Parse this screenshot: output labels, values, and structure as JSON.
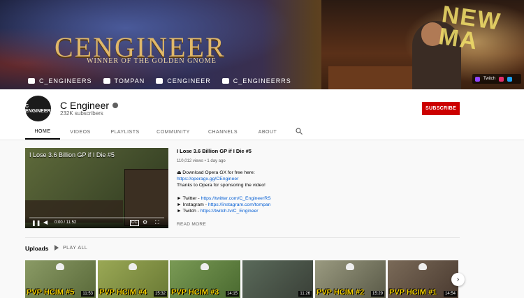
{
  "banner": {
    "brand": "CENGINEER",
    "tagline": "WINNER OF THE GOLDEN GNOME",
    "neon": "NEW\nMA",
    "socials": [
      {
        "icon": "twitter-icon",
        "label": "C_ENGINEERS"
      },
      {
        "icon": "instagram-icon",
        "label": "TOMPAN"
      },
      {
        "icon": "youtube-icon",
        "label": "CENGINEER"
      },
      {
        "icon": "twitch-icon",
        "label": "C_ENGINEERRS"
      }
    ],
    "links_chip": {
      "twitch_label": "Twitch"
    }
  },
  "channel": {
    "avatar_text": "C ENGINEER",
    "name": "C Engineer",
    "subscribers": "232K subscribers",
    "subscribe_label": "SUBSCRIBE"
  },
  "tabs": [
    {
      "label": "HOME",
      "active": true
    },
    {
      "label": "VIDEOS"
    },
    {
      "label": "PLAYLISTS"
    },
    {
      "label": "COMMUNITY"
    },
    {
      "label": "CHANNELS"
    },
    {
      "label": "ABOUT"
    }
  ],
  "featured": {
    "title": "I Lose 3.6 Billion GP if I Die #5",
    "player_title": "I Lose 3.6 Billion GP if I Die #5",
    "time": "0:00 / 11:52",
    "views": "110,012 views",
    "age": "1 day ago",
    "description": {
      "line1": "⏏ Download Opera GX for free here:",
      "link1": "https://operagx.gg/CEngineer",
      "line2": "Thanks to Opera for sponsoring the video!",
      "twitter_prefix": "► Twitter - ",
      "twitter_link": "https://twitter.com/C_EngineerRS",
      "instagram_prefix": "► Instagram - ",
      "instagram_link": "https://instagram.com/tompan",
      "twitch_prefix": "► Twitch - ",
      "twitch_link": "https://twitch.tv/C_Engineer"
    },
    "read_more": "READ MORE"
  },
  "uploads": {
    "title": "Uploads",
    "play_all": "PLAY ALL",
    "videos": [
      {
        "label": "PVP HCIM #5",
        "duration": "11:53",
        "bg": "#7a8a55"
      },
      {
        "label": "PVP HCIM #4",
        "duration": "15:32",
        "bg": "#8a9a4a"
      },
      {
        "label": "PVP HCIM #3",
        "duration": "14:15",
        "bg": "#6a8a45"
      },
      {
        "label": "",
        "duration": "11:26",
        "bg": "#4a5a4a"
      },
      {
        "label": "PVP HCIM #2",
        "duration": "15:29",
        "bg": "#8a8a70"
      },
      {
        "label": "PVP HCIM #1",
        "duration": "14:54",
        "bg": "#6a5a4a"
      }
    ]
  },
  "colors": {
    "subscribe": "#cc0000",
    "link": "#065fd4",
    "thumb_text": "#f5d000"
  }
}
